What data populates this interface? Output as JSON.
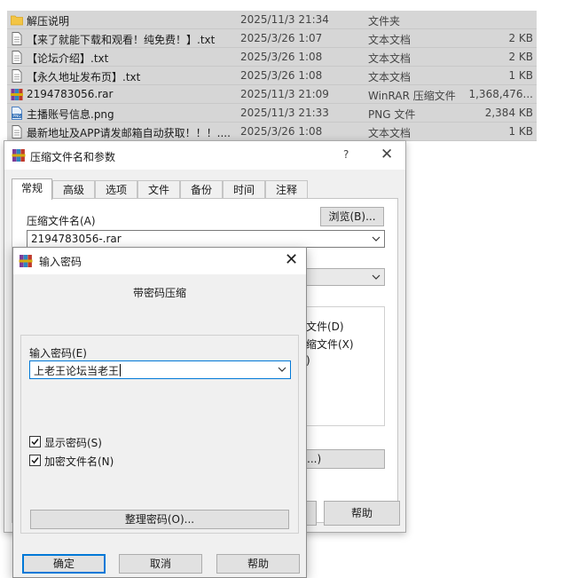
{
  "files": [
    {
      "name": "解压说明",
      "date": "2025/11/3 21:34",
      "type": "文件夹",
      "size": "",
      "icon": "folder-icon"
    },
    {
      "name": "【来了就能下载和观看！纯免费！】.txt",
      "date": "2025/3/26 1:07",
      "type": "文本文档",
      "size": "2 KB",
      "icon": "text-file-icon"
    },
    {
      "name": "【论坛介绍】.txt",
      "date": "2025/3/26 1:08",
      "type": "文本文档",
      "size": "2 KB",
      "icon": "text-file-icon"
    },
    {
      "name": "【永久地址发布页】.txt",
      "date": "2025/3/26 1:08",
      "type": "文本文档",
      "size": "1 KB",
      "icon": "text-file-icon"
    },
    {
      "name": "2194783056.rar",
      "date": "2025/11/3 21:09",
      "type": "WinRAR 压缩文件",
      "size": "1,368,476...",
      "icon": "winrar-archive-icon"
    },
    {
      "name": "主播账号信息.png",
      "date": "2025/11/3 21:33",
      "type": "PNG 文件",
      "size": "2,384 KB",
      "icon": "png-file-icon"
    },
    {
      "name": "最新地址及APP请发邮箱自动获取！！！....",
      "date": "2025/3/26 1:08",
      "type": "文本文档",
      "size": "1 KB",
      "icon": "text-file-icon"
    }
  ],
  "archive_dialog": {
    "title": "压缩文件名和参数",
    "help_glyph": "?",
    "close_glyph": "✕",
    "tabs": [
      "常规",
      "高级",
      "选项",
      "文件",
      "备份",
      "时间",
      "注释"
    ],
    "archive_name_label": "压缩文件名(A)",
    "browse_label": "浏览(B)...",
    "archive_name_value": "2194783056-.rar",
    "partial_text": [
      "文件(D)",
      "缩文件(X)",
      ")",
      "...)"
    ],
    "help_label": "帮助"
  },
  "password_dialog": {
    "title": "输入密码",
    "close_glyph": "✕",
    "heading": "带密码压缩",
    "password_label": "输入密码(E)",
    "password_value": "上老王论坛当老王",
    "show_password_label": "显示密码(S)",
    "show_password_checked": true,
    "encrypt_names_label": "加密文件名(N)",
    "encrypt_names_checked": true,
    "manage_label": "整理密码(O)...",
    "ok_label": "确定",
    "cancel_label": "取消",
    "help_label": "帮助"
  },
  "colors": {
    "accent": "#0078d7",
    "row_selected": "#d6d6d6",
    "dialog_bg": "#f0f0f0"
  }
}
